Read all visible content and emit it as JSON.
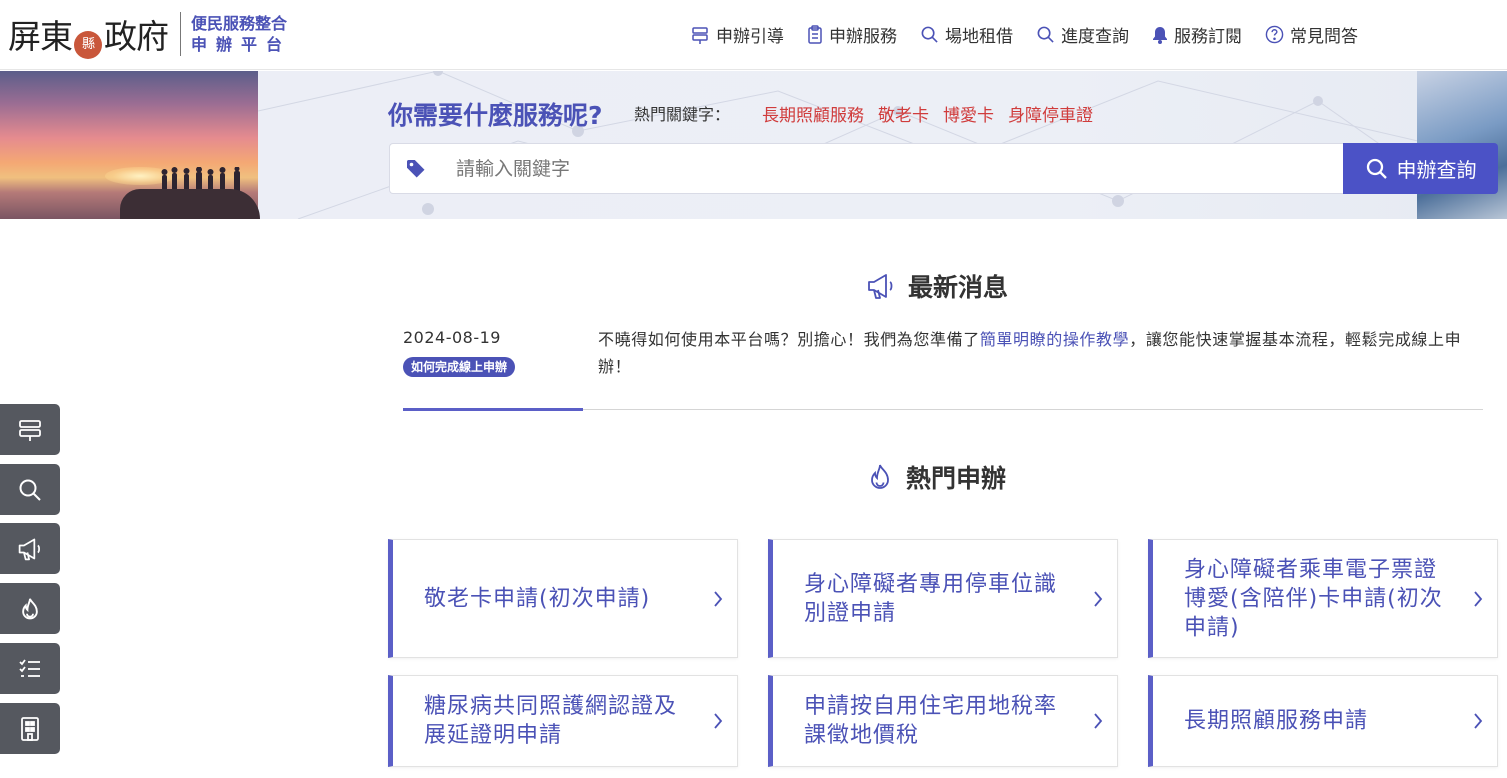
{
  "header": {
    "logo_text": "屏東縣政府",
    "logo_seal": "縣",
    "logo_sub_line1": "便民服務整合",
    "logo_sub_line2": "申辦平台",
    "nav": [
      {
        "label": "申辦引導",
        "icon": "signpost-icon"
      },
      {
        "label": "申辦服務",
        "icon": "clipboard-icon"
      },
      {
        "label": "場地租借",
        "icon": "search-icon"
      },
      {
        "label": "進度查詢",
        "icon": "search-icon"
      },
      {
        "label": "服務訂閱",
        "icon": "bell-icon"
      },
      {
        "label": "常見問答",
        "icon": "question-icon"
      }
    ]
  },
  "banner": {
    "question": "你需要什麼服務呢?",
    "keyword_label": "熱門關鍵字：",
    "keywords": [
      "長期照顧服務",
      "敬老卡",
      "博愛卡",
      "身障停車證"
    ],
    "search_placeholder": "請輸入關鍵字",
    "search_button": "申辦查詢"
  },
  "news": {
    "title": "最新消息",
    "items": [
      {
        "date": "2024-08-19",
        "badge": "如何完成線上申辦",
        "text_before": "不曉得如何使用本平台嗎？別擔心！我們為您準備了",
        "link": "簡單明瞭的操作教學",
        "text_after": "，讓您能快速掌握基本流程，輕鬆完成線上申辦！"
      }
    ]
  },
  "hot": {
    "title": "熱門申辦",
    "cards": [
      "敬老卡申請(初次申請)",
      "身心障礙者專用停車位識別證申請",
      "身心障礙者乘車電子票證博愛(含陪伴)卡申請(初次申請)",
      "糖尿病共同照護網認證及展延證明申請",
      "申請按自用住宅用地稅率課徵地價稅",
      "長期照顧服務申請"
    ]
  },
  "side_buttons": [
    "signpost-icon",
    "search-icon",
    "megaphone-icon",
    "flame-icon",
    "checklist-icon",
    "building-icon"
  ],
  "colors": {
    "accent": "#4b52b6",
    "button": "#4b52c6",
    "keyword": "#d03c3c",
    "side": "#55585f"
  }
}
